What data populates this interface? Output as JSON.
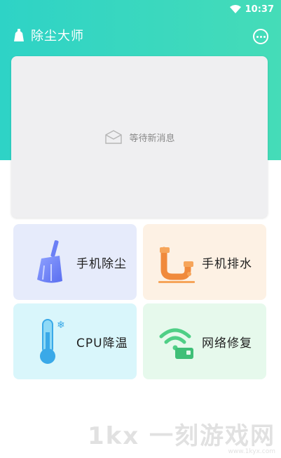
{
  "status_bar": {
    "time": "10:37"
  },
  "app_bar": {
    "title": "除尘大师"
  },
  "message_card": {
    "empty_text": "等待新消息"
  },
  "tools": [
    {
      "label": "手机除尘",
      "icon": "broom-icon"
    },
    {
      "label": "手机排水",
      "icon": "pipe-faucet-icon"
    },
    {
      "label": "CPU降温",
      "icon": "thermometer-icon"
    },
    {
      "label": "网络修复",
      "icon": "wifi-repair-icon"
    }
  ],
  "watermark": {
    "logo": "1kx 一刻游戏网",
    "url": "www.1kyx.com"
  },
  "colors": {
    "header": "#2ed3c6",
    "tile_dust": "#e6ebfb",
    "tile_drain": "#fdf1e4",
    "tile_cpu": "#d9f6fb",
    "tile_network": "#e6f9ec"
  }
}
